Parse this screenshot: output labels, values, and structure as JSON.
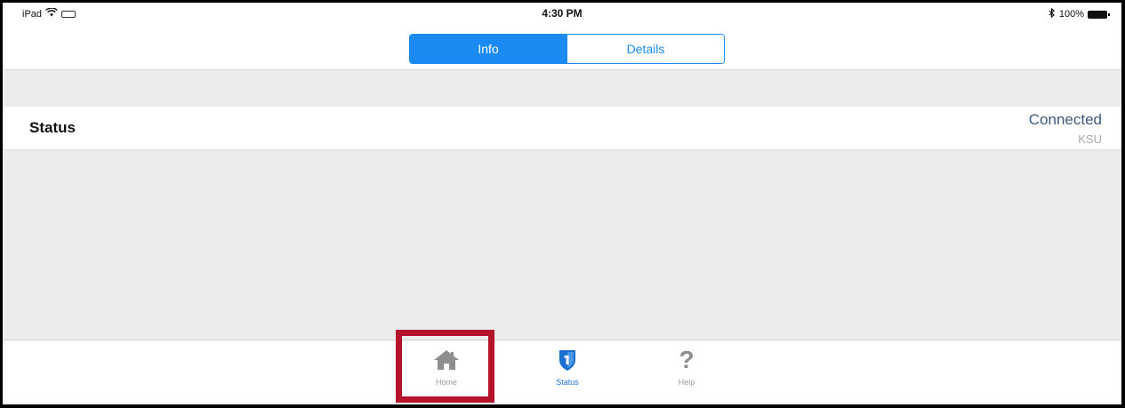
{
  "statusbar": {
    "device": "iPad",
    "time": "4:30 PM",
    "battery": "100%"
  },
  "segmented": {
    "info": "Info",
    "details": "Details"
  },
  "status_row": {
    "label": "Status",
    "value": "Connected",
    "sub": "KSU"
  },
  "tabbar": {
    "home": "Home",
    "status": "Status",
    "help": "Help"
  },
  "colors": {
    "accent": "#1b8af2",
    "highlight": "#b5122b",
    "background": "#ececec"
  },
  "icons": [
    "wifi-icon",
    "battery-icon",
    "bluetooth-icon",
    "home-icon",
    "shield-icon",
    "help-icon"
  ]
}
